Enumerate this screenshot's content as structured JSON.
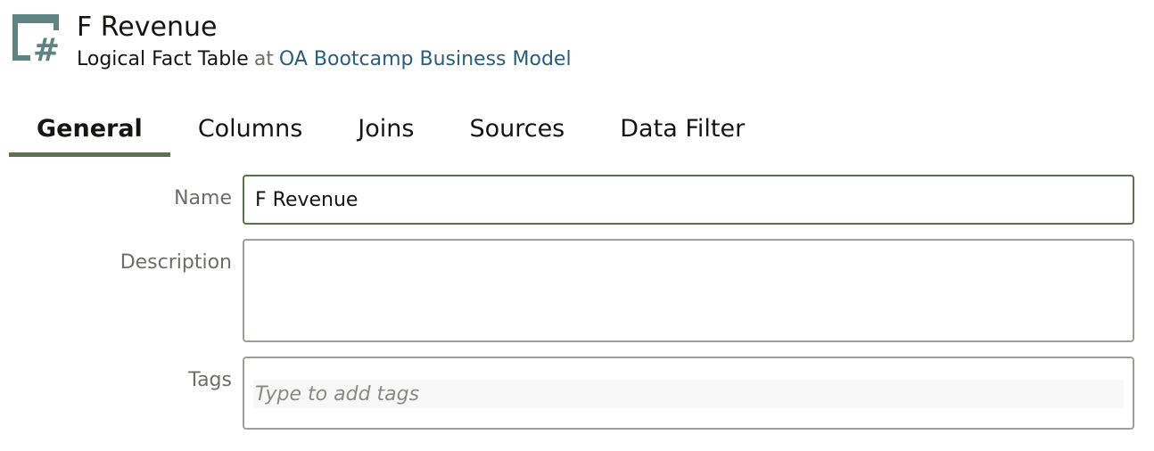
{
  "header": {
    "icon": "logical-fact-table-icon",
    "title": "F Revenue",
    "object_type": "Logical Fact Table",
    "at_word": "at",
    "parent_model": "OA Bootcamp Business Model"
  },
  "tabs": [
    {
      "label": "General",
      "active": true
    },
    {
      "label": "Columns",
      "active": false
    },
    {
      "label": "Joins",
      "active": false
    },
    {
      "label": "Sources",
      "active": false
    },
    {
      "label": "Data Filter",
      "active": false
    }
  ],
  "form": {
    "name": {
      "label": "Name",
      "value": "F Revenue"
    },
    "description": {
      "label": "Description",
      "value": ""
    },
    "tags": {
      "label": "Tags",
      "placeholder": "Type to add tags"
    }
  },
  "colors": {
    "accent": "#5b7349",
    "link": "#2b5e7c",
    "icon": "#5f8383",
    "label": "#6f6c69"
  }
}
